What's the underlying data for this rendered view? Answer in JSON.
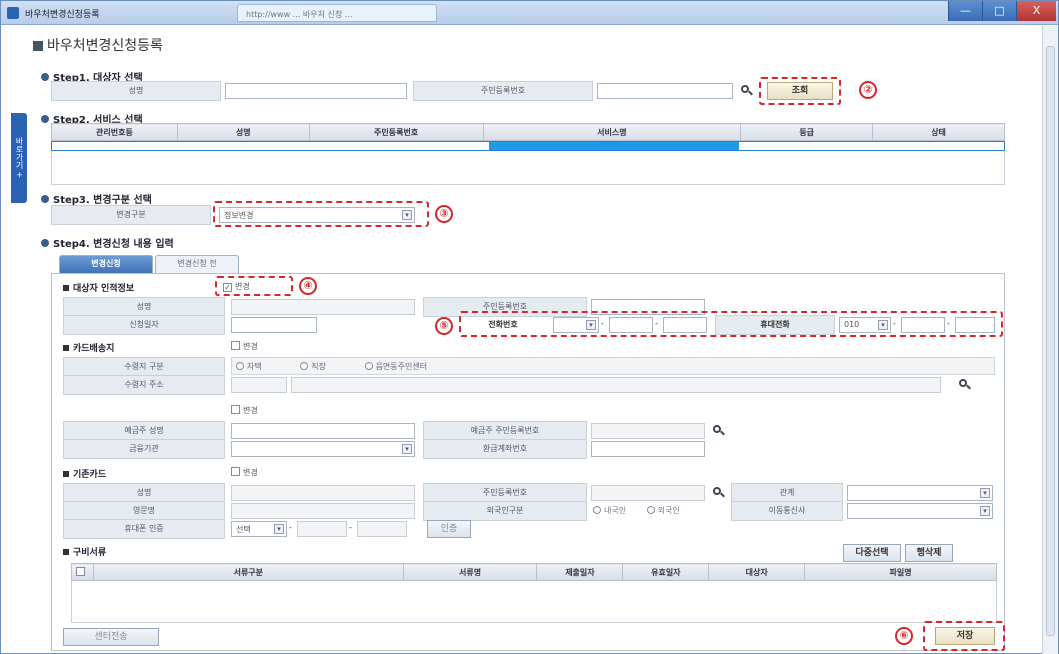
{
  "window": {
    "title": "바우처변경신청등록",
    "tab_text": "http://www ... 바우처 신청 ...",
    "controls": [
      "—",
      "□",
      "X"
    ]
  },
  "side_tab": {
    "label": "바로가기 +"
  },
  "page_title": "바우처변경신청등록",
  "step1": {
    "title": "Step1. 대상자 선택",
    "name_label": "성명",
    "name_value": "",
    "rrn_label": "주민등록번호",
    "rrn_value": "",
    "search_button": "조회",
    "callout": "②"
  },
  "step2": {
    "title": "Step2. 서비스 선택",
    "columns": [
      "관리번호등",
      "성명",
      "주민등록번호",
      "서비스명",
      "등급",
      "상태"
    ]
  },
  "step3": {
    "title": "Step3. 변경구분 선택",
    "change_type_label": "변경구분",
    "change_type_value": "정보변경",
    "callout": "③"
  },
  "step4": {
    "title": "Step4. 변경신청 내용 입력",
    "tabs": [
      {
        "label": "변경신청",
        "active": true
      },
      {
        "label": "변경신청 전",
        "active": false
      }
    ],
    "personal": {
      "title": "대상자 인적정보",
      "change_checkbox": "변경",
      "callout4": "④",
      "name_label": "성명",
      "rrn_label": "주민등록번호",
      "apply_date_label": "신청일자",
      "callout5": "⑤",
      "phone_label": "전화번호",
      "mobile_label": "휴대전화",
      "mobile_prefix": "010"
    },
    "card_delivery": {
      "title": "카드배송지",
      "change_checkbox": "변경",
      "receive_type_label": "수령지 구분",
      "receive_options": [
        "자택",
        "직장",
        "읍면동주민센터"
      ],
      "address_label": "수령지 주소"
    },
    "account": {
      "change_checkbox": "변경",
      "holder_name_label": "예금주 성명",
      "holder_rrn_label": "예금주 주민등록번호",
      "bank_label": "금융기관",
      "refund_account_label": "환급계좌번호"
    },
    "existing_card": {
      "title": "기존카드",
      "change_checkbox": "변경",
      "name_label": "성명",
      "rrn_label": "주민등록번호",
      "relation_label": "관계",
      "eng_name_label": "영문명",
      "foreign_type_label": "외국인구분",
      "foreign_options": [
        "내국인",
        "외국인"
      ],
      "carrier_label": "이동통신사",
      "mobile_auth_label": "휴대폰 인증",
      "mobile_auth_select": "선택",
      "auth_button": "인증"
    },
    "documents": {
      "title": "구비서류",
      "multi_select_button": "다중선택",
      "delete_button": "행삭제",
      "columns": [
        "서류구분",
        "서류명",
        "제출일자",
        "유효일자",
        "대상자",
        "파일명"
      ]
    },
    "center_send_button": "센터전송",
    "save_button": "저장",
    "callout6": "⑥"
  },
  "colors": {
    "accent_red": "#d62828",
    "title_bar": "#b7cde9",
    "tab_active": "#3f72b7",
    "selected_row": "#1e9be8"
  }
}
